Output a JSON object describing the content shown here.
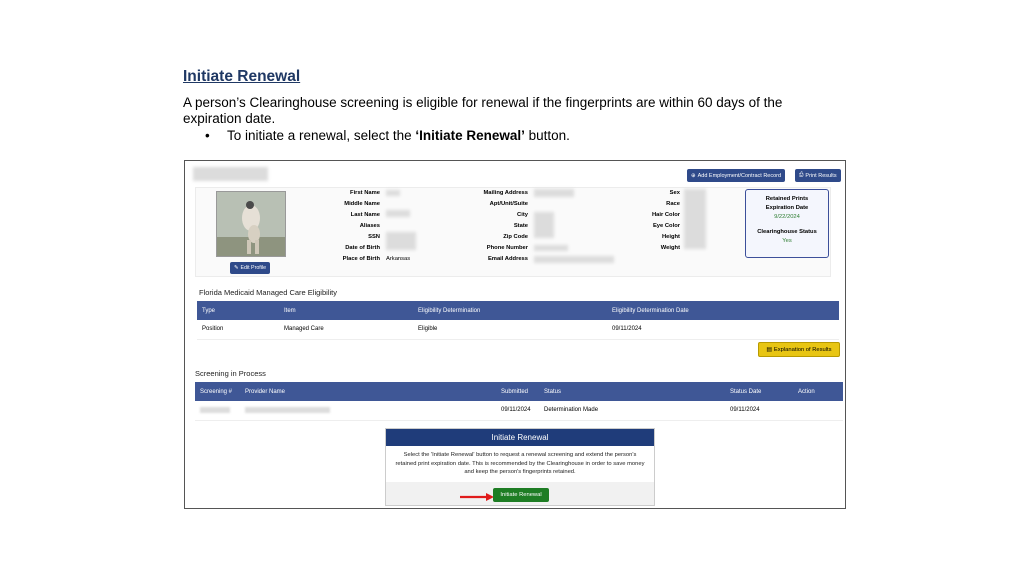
{
  "doc": {
    "heading": "Initiate Renewal",
    "intro": "A person’s Clearinghouse screening is eligible for renewal if the fingerprints are within 60 days of the expiration date.",
    "bullet_pre": "To initiate a renewal, select the ",
    "bullet_bold": "‘Initiate Renewal’",
    "bullet_post": " button."
  },
  "toolbar": {
    "add_record": "Add Employment/Contract Record",
    "print_results": "Print Results"
  },
  "profile": {
    "edit_profile": "Edit Profile",
    "col1_labels": [
      "First Name",
      "Middle Name",
      "Last Name",
      "Aliases",
      "SSN",
      "Date of Birth",
      "Place of Birth"
    ],
    "place_of_birth": "Arkansas",
    "col2_labels": [
      "Mailing Address",
      "Apt/Unit/Suite",
      "City",
      "State",
      "Zip Code",
      "Phone Number",
      "Email Address"
    ],
    "col3_labels": [
      "Sex",
      "Race",
      "Hair Color",
      "Eye Color",
      "Height",
      "Weight"
    ]
  },
  "retained": {
    "title_line1": "Retained Prints",
    "title_line2": "Expiration Date",
    "date": "9/22/2024",
    "status_label": "Clearinghouse Status",
    "status_value": "Yes"
  },
  "medicaid": {
    "title": "Florida Medicaid Managed Care Eligibility",
    "headers": [
      "Type",
      "Item",
      "Eligibility Determination",
      "Eligibility Determination Date"
    ],
    "row": [
      "Position",
      "Managed Care",
      "Eligible",
      "09/11/2024"
    ],
    "explanation_button": "Explanation of Results"
  },
  "screening": {
    "title": "Screening in Process",
    "headers": [
      "Screening #",
      "Provider Name",
      "Submitted",
      "Status",
      "Status Date",
      "Action"
    ],
    "row": {
      "submitted": "09/11/2024",
      "status": "Determination Made",
      "status_date": "09/11/2024"
    }
  },
  "renew_panel": {
    "header": "Initiate Renewal",
    "body": "Select the 'Initiate Renewal' button to request a renewal screening and extend the person's retained print expiration date. This is recommended by the Clearinghouse in order to save money and keep the person's fingerprints retained.",
    "button": "Initiate Renewal"
  },
  "colors": {
    "primary": "#3f5796",
    "accent_green": "#1e7d24",
    "warning": "#e8c513",
    "arrow": "#e01b1b"
  }
}
